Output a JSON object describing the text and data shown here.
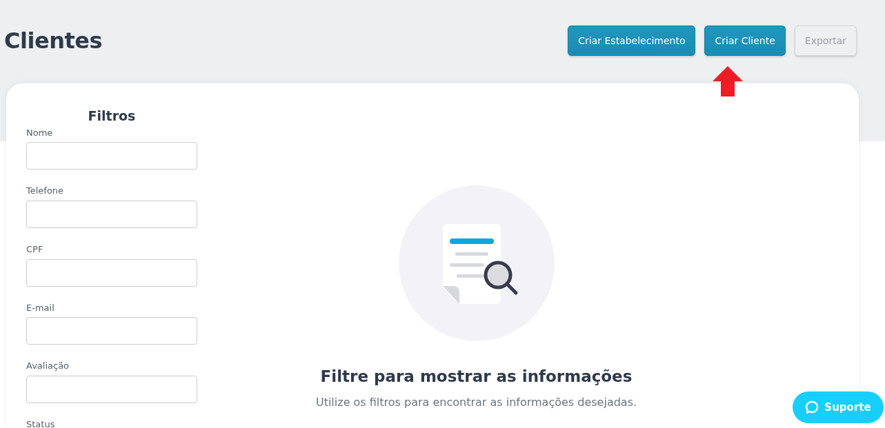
{
  "page": {
    "title": "Clientes"
  },
  "actions": [
    {
      "label": "Criar Estabelecimento",
      "disabled": false
    },
    {
      "label": "Criar Cliente",
      "disabled": false
    },
    {
      "label": "Exportar",
      "disabled": true
    }
  ],
  "filters": {
    "title": "Filtros",
    "fields": [
      {
        "label": "Nome"
      },
      {
        "label": "Telefone"
      },
      {
        "label": "CPF"
      },
      {
        "label": "E-mail"
      },
      {
        "label": "Avaliação"
      },
      {
        "label": "Status"
      }
    ]
  },
  "empty_state": {
    "title": "Filtre para mostrar as informações",
    "message": "Utilize os filtros para encontrar as informações desejadas."
  },
  "support_button": {
    "label": "Suporte"
  }
}
